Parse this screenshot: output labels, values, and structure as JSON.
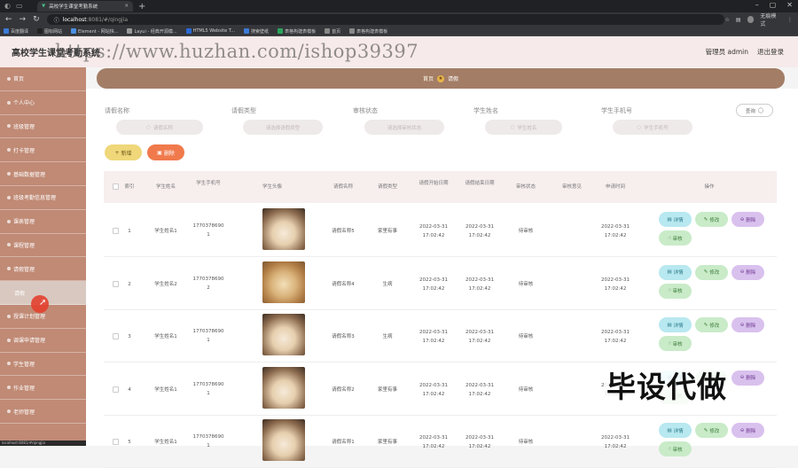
{
  "browser": {
    "tab_title": "高校学生课堂考勤系统",
    "url_host": "localhost",
    "url_rest": ":8081/#/qingjia",
    "profile": "无痕模式",
    "bookmarks": [
      "百度翻译",
      "图标网站",
      "Element - 网站快...",
      "Layui - 经典开源模...",
      "HTML5 Website T...",
      "搜索壁纸",
      "表格构建表模板",
      "首页",
      "表格构建表模板"
    ]
  },
  "header": {
    "title": "高校学生课堂考勤系统",
    "user": "管理员 admin",
    "logout": "退出登录"
  },
  "watermark": "https://www.huzhan.com/ishop39397",
  "sidebar": {
    "items": [
      "首页",
      "个人中心",
      "班级管理",
      "打卡管理",
      "基础数据管理",
      "班级考勤信息管理",
      "课表管理",
      "课程管理",
      "请假管理",
      "请假",
      "授课计划管理",
      "调课申请管理",
      "学生管理",
      "作业管理",
      "老师管理"
    ]
  },
  "breadcrumb": {
    "home": "首页",
    "current": "请假"
  },
  "filters": {
    "labels": [
      "请假名称",
      "请假类型",
      "审核状态",
      "学生姓名",
      "学生手机号"
    ],
    "placeholders": [
      "请假名称",
      "请选择请假类型",
      "请选择审核状态",
      "学生姓名",
      "学生手机号"
    ],
    "search": "查询"
  },
  "actions": {
    "add": "新增",
    "delete": "删除"
  },
  "table": {
    "headers": [
      "索引",
      "学生姓名",
      "学生手机号",
      "学生头像",
      "请假名称",
      "请假类型",
      "请假开始日期",
      "请假结束日期",
      "审核状态",
      "审核意见",
      "申请时间",
      "操作"
    ],
    "rows": [
      {
        "index": "1",
        "name": "学生姓名1",
        "phone1": "1770378690",
        "phone2": "1",
        "title": "请假名称5",
        "type": "家里有事",
        "start1": "2022-03-31",
        "start2": "17:02:42",
        "end1": "2022-03-31",
        "end2": "17:02:42",
        "status": "待审核",
        "opinion": "",
        "time1": "2022-03-31",
        "time2": "17:02:42",
        "pic": "cat1"
      },
      {
        "index": "2",
        "name": "学生姓名2",
        "phone1": "1770378690",
        "phone2": "2",
        "title": "请假名称4",
        "type": "生病",
        "start1": "2022-03-31",
        "start2": "17:02:42",
        "end1": "2022-03-31",
        "end2": "17:02:42",
        "status": "待审核",
        "opinion": "",
        "time1": "2022-03-31",
        "time2": "17:02:42",
        "pic": "cat2"
      },
      {
        "index": "3",
        "name": "学生姓名1",
        "phone1": "1770378690",
        "phone2": "1",
        "title": "请假名称3",
        "type": "生病",
        "start1": "2022-03-31",
        "start2": "17:02:42",
        "end1": "2022-03-31",
        "end2": "17:02:42",
        "status": "待审核",
        "opinion": "",
        "time1": "2022-03-31",
        "time2": "17:02:42",
        "pic": "cat1"
      },
      {
        "index": "4",
        "name": "学生姓名1",
        "phone1": "1770378690",
        "phone2": "1",
        "title": "请假名称2",
        "type": "家里有事",
        "start1": "2022-03-31",
        "start2": "17:02:42",
        "end1": "2022-03-31",
        "end2": "17:02:42",
        "status": "待审核",
        "opinion": "",
        "time1": "2022-03-31",
        "time2": "17:02:42",
        "pic": "cat1"
      },
      {
        "index": "5",
        "name": "学生姓名1",
        "phone1": "1770378690",
        "phone2": "1",
        "title": "请假名称1",
        "type": "家里有事",
        "start1": "2022-03-31",
        "start2": "17:02:42",
        "end1": "2022-03-31",
        "end2": "17:02:42",
        "status": "待审核",
        "opinion": "",
        "time1": "2022-03-31",
        "time2": "17:02:42",
        "pic": "cat1"
      }
    ],
    "ops": {
      "detail": "详情",
      "edit": "修改",
      "del": "删除",
      "audit": "审核"
    }
  },
  "overlay_text": "毕设代做",
  "colors": {
    "sidebar": "#c08a75",
    "breadcrumb": "#a37d66",
    "header_bg": "#f7eaea",
    "add": "#efd77a",
    "delete": "#f07a4c"
  }
}
